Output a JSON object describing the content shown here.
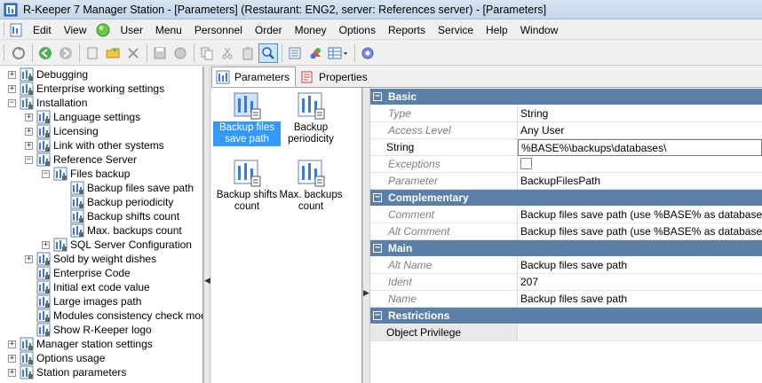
{
  "window": {
    "title": "R-Keeper 7 Manager Station - [Parameters] (Restaurant: ENG2, server: References server) - [Parameters]"
  },
  "menu": [
    "Edit",
    "View",
    "User",
    "Menu",
    "Personnel",
    "Order",
    "Money",
    "Options",
    "Reports",
    "Service",
    "Help",
    "Window"
  ],
  "tree": {
    "items": [
      {
        "label": "Debugging",
        "level": 0,
        "expander": "+"
      },
      {
        "label": "Enterprise working settings",
        "level": 0,
        "expander": "+"
      },
      {
        "label": "Installation",
        "level": 0,
        "expander": "-"
      },
      {
        "label": "Language settings",
        "level": 1,
        "expander": "+"
      },
      {
        "label": "Licensing",
        "level": 1,
        "expander": "+"
      },
      {
        "label": "Link with other systems",
        "level": 1,
        "expander": "+"
      },
      {
        "label": "Reference Server",
        "level": 1,
        "expander": "-"
      },
      {
        "label": "Files backup",
        "level": 2,
        "expander": "-"
      },
      {
        "label": "Backup files save path",
        "level": 3,
        "expander": ""
      },
      {
        "label": "Backup periodicity",
        "level": 3,
        "expander": ""
      },
      {
        "label": "Backup shifts count",
        "level": 3,
        "expander": ""
      },
      {
        "label": "Max. backups count",
        "level": 3,
        "expander": ""
      },
      {
        "label": "SQL Server Configuration",
        "level": 2,
        "expander": "+"
      },
      {
        "label": "Sold by weight dishes",
        "level": 1,
        "expander": "+"
      },
      {
        "label": "Enterprise Code",
        "level": 1,
        "expander": ""
      },
      {
        "label": "Initial ext code value",
        "level": 1,
        "expander": ""
      },
      {
        "label": "Large images path",
        "level": 1,
        "expander": ""
      },
      {
        "label": "Modules consistency check mode",
        "level": 1,
        "expander": ""
      },
      {
        "label": "Show R-Keeper logo",
        "level": 1,
        "expander": ""
      },
      {
        "label": "Manager station settings",
        "level": 0,
        "expander": "+"
      },
      {
        "label": "Options usage",
        "level": 0,
        "expander": "+"
      },
      {
        "label": "Station parameters",
        "level": 0,
        "expander": "+"
      }
    ]
  },
  "tabs": {
    "parameters": "Parameters",
    "properties": "Properties"
  },
  "icons": [
    {
      "label": "Backup files save path",
      "selected": true
    },
    {
      "label": "Backup periodicity",
      "selected": false
    },
    {
      "label": "Backup shifts count",
      "selected": false
    },
    {
      "label": "Max. backups count",
      "selected": false
    }
  ],
  "propgrid": {
    "categories": {
      "basic": "Basic",
      "complementary": "Complementary",
      "main": "Main",
      "restrictions": "Restrictions"
    },
    "rows": {
      "type": {
        "name": "Type",
        "value": "String"
      },
      "access_level": {
        "name": "Access Level",
        "value": "Any User"
      },
      "string": {
        "name": "String",
        "value": "%BASE%\\backups\\databases\\"
      },
      "exceptions": {
        "name": "Exceptions",
        "value": ""
      },
      "parameter": {
        "name": "Parameter",
        "value": "BackupFilesPath"
      },
      "comment": {
        "name": "Comment",
        "value": "Backup files save path (use %BASE% as database path)"
      },
      "alt_comment": {
        "name": "Alt Comment",
        "value": "Backup files save path (use %BASE% as database path)"
      },
      "alt_name": {
        "name": "Alt Name",
        "value": "Backup files save path"
      },
      "ident": {
        "name": "Ident",
        "value": "207"
      },
      "name": {
        "name": "Name",
        "value": "Backup files save path"
      },
      "object_privilege": {
        "name": "Object Privilege",
        "value": ""
      }
    }
  },
  "colors": {
    "category_bg": "#5a7fa8",
    "selection": "#3399ff"
  }
}
